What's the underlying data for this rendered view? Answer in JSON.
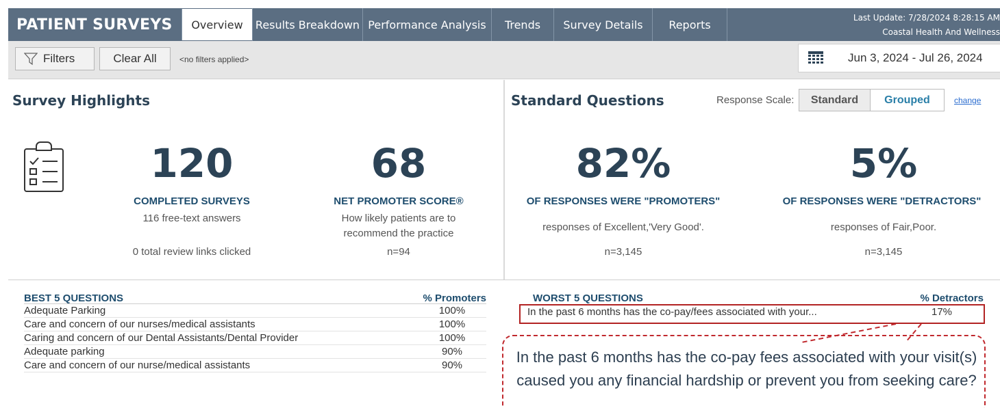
{
  "app": {
    "title": "PATIENT SURVEYS",
    "last_update": "Last Update: 7/28/2024 8:28:15 AM",
    "organization": "Coastal Health And Wellness"
  },
  "tabs": [
    {
      "label": "Overview",
      "active": true
    },
    {
      "label": "Results Breakdown",
      "active": false
    },
    {
      "label": "Performance Analysis",
      "active": false
    },
    {
      "label": "Trends",
      "active": false
    },
    {
      "label": "Survey Details",
      "active": false
    },
    {
      "label": "Reports",
      "active": false
    }
  ],
  "filters": {
    "filters_label": "Filters",
    "clear_label": "Clear All",
    "status": "<no filters applied>",
    "date_range": "Jun 3, 2024 - Jul 26, 2024"
  },
  "highlights": {
    "title": "Survey Highlights",
    "completed": {
      "value": "120",
      "label": "COMPLETED SURVEYS",
      "sub1": "116 free-text answers",
      "sub2": "0  total review links clicked"
    },
    "nps": {
      "value": "68",
      "label": "NET PROMOTER SCORE®",
      "sub1": "How likely patients are to",
      "sub2": "recommend the practice",
      "n": "n=94"
    }
  },
  "standard": {
    "title": "Standard Questions",
    "response_scale_label": "Response Scale:",
    "scale_standard": "Standard",
    "scale_grouped": "Grouped",
    "change_link": "change",
    "promoters": {
      "value": "82%",
      "label": "OF RESPONSES WERE \"PROMOTERS\"",
      "sub": "responses of Excellent,'Very Good'.",
      "n": "n=3,145"
    },
    "detractors": {
      "value": "5%",
      "label": "OF RESPONSES WERE \"DETRACTORS\"",
      "sub": "responses of Fair,Poor.",
      "n": "n=3,145"
    }
  },
  "best": {
    "header": "BEST 5 QUESTIONS",
    "pct_header": "% Promoters",
    "rows": [
      {
        "question": "Adequate Parking",
        "pct": "100%"
      },
      {
        "question": "Care and concern of our nurses/medical assistants",
        "pct": "100%"
      },
      {
        "question": "Caring and concern of our Dental Assistants/Dental Provider",
        "pct": "100%"
      },
      {
        "question": "Adequate parking",
        "pct": "90%"
      },
      {
        "question": "Care and concern of our nurse/medical assistants",
        "pct": "90%"
      }
    ]
  },
  "worst": {
    "header": "WORST 5 QUESTIONS",
    "pct_header": "% Detractors",
    "rows": [
      {
        "question": "In the past 6 months has the co-pay/fees associated with your...",
        "pct": "17%"
      }
    ]
  },
  "callout": {
    "text": "In the past 6 months has the co-pay fees associated with your visit(s) caused you any financial hardship or prevent you from seeking care?"
  },
  "colors": {
    "nav": "#5b6e82",
    "heading": "#2c4356",
    "accent": "#2a7fa8",
    "callout_border": "#c0282d"
  }
}
